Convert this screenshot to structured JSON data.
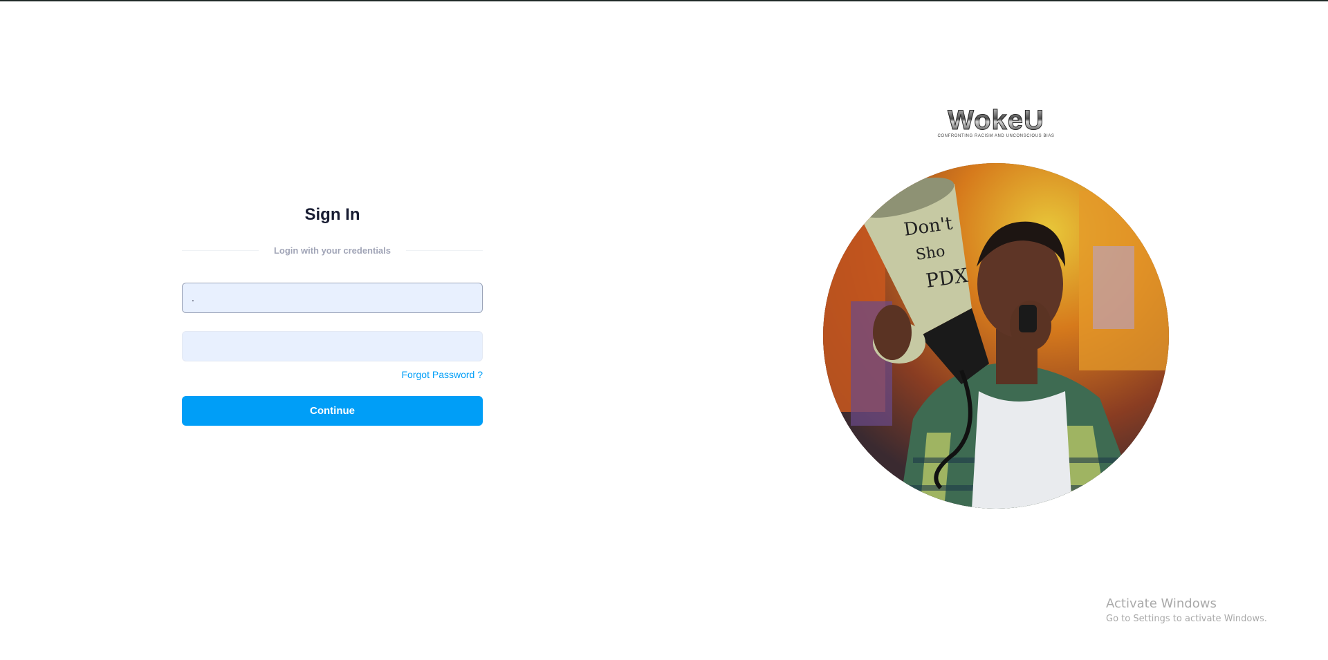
{
  "signin": {
    "title": "Sign In",
    "separator_text": "Login with your credentials",
    "email_value": ".",
    "password_value": "",
    "forgot_label": "Forgot Password ?",
    "continue_label": "Continue"
  },
  "brand": {
    "logo_text": "WokeU",
    "tagline": "CONFRONTING RACISM AND UNCONSCIOUS BIAS"
  },
  "hero": {
    "image": "protester-with-megaphone-photo",
    "megaphone_text": "Don't Shoot PDX"
  },
  "watermark": {
    "title": "Activate Windows",
    "subtitle": "Go to Settings to activate Windows."
  },
  "colors": {
    "accent": "#009ef7",
    "field_bg": "#e8f0fe",
    "title": "#181c32",
    "muted": "#a1a5b7"
  }
}
